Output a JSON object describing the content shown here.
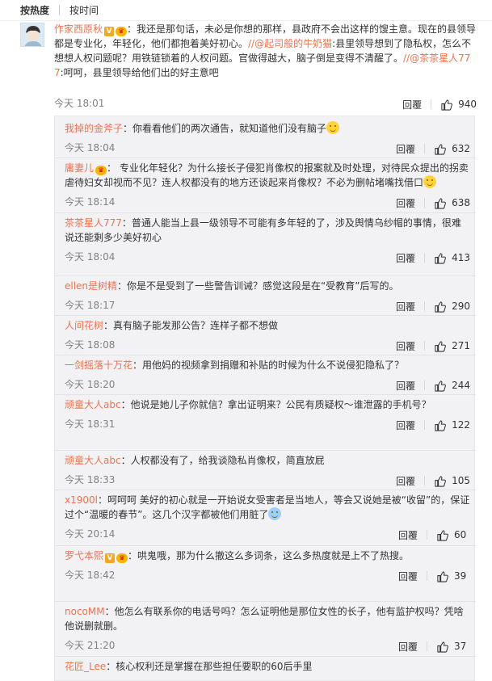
{
  "sort": {
    "hot": "按热度",
    "time": "按时间"
  },
  "main": {
    "user": "作家西原秋",
    "text1": "：我还是那句话，未必是你想的那样，县政府不会出这样的馊主意。现在的县领导都是专业化，年轻化，他们都抱着美好初心。",
    "mention1": "//@起司般的牛奶猫",
    "text2": ":县里领导想到了隐私权，怎么不想想人权问题呢？用铁链锁着的人权问题。官做得越大，脑子倒是变得不清醒了。",
    "mention2": "//@茶茶星人777",
    "text3": ":呵呵，县里领导给他们出的好主意吧",
    "time": "今天 18:01",
    "reply": "回覆",
    "likes": "940"
  },
  "replies": [
    {
      "user": "我掉的金斧子",
      "text": "：你看看他们的两次通告，就知道他们没有脑子",
      "emoji": "smile",
      "time": "今天 18:04",
      "reply": "回覆",
      "likes": "632"
    },
    {
      "user": "庸妻儿",
      "vip": true,
      "text": "： 专业化年轻化？为什么接长子侵犯肖像权的报案就及时处理，对待民众提出的拐卖虐待妇女却视而不见？连人权都没有的地方还谈起来肖像权？不必为删帖堵嘴找借口",
      "emoji": "smile",
      "time": "今天 18:14",
      "reply": "回覆",
      "likes": "638"
    },
    {
      "user": "茶茶星人777",
      "text": "：普通人能当上县一级领导不可能有多年轻的了，涉及舆情乌纱帽的事情，很难说还能剩多少美好初心",
      "time": "今天 18:04",
      "reply": "回覆",
      "likes": "413"
    },
    {
      "user": "ellen是树精",
      "text": "：你是不是受到了一些警告训诫？感觉这段是在“受教育”后写的。",
      "time": "今天 18:17",
      "reply": "回覆",
      "likes": "290"
    },
    {
      "user": "人间花树",
      "text": "：真有脑子能发那公告？连样子都不想做",
      "time": "今天 18:08",
      "reply": "回覆",
      "likes": "271"
    },
    {
      "user": "一剑摇落十万花",
      "text": "：用他妈的视频拿到捐赠和补贴的时候为什么不说侵犯隐私了？",
      "time": "今天 18:20",
      "reply": "回覆",
      "likes": "244"
    },
    {
      "user": "顽童大人abc",
      "text": "：他说是她儿子你就信？拿出证明来？公民有质疑权～谁泄露的手机号？",
      "time": "今天 18:31",
      "reply": "回覆",
      "likes": "122"
    },
    {
      "user": "顽童大人abc",
      "text": "：人权都没有了，给我谈隐私肖像权，简直放屁",
      "time": "今天 18:33",
      "reply": "回覆",
      "likes": "105"
    },
    {
      "user": "x1900l",
      "text": "：呵呵呵 美好的初心就是一开始说女受害者是当地人，等会又说她是被“收留”的，保证过个“温暖的春节”。这几个汉字都被他们用脏了",
      "emoji": "cry",
      "time": "今天 20:14",
      "reply": "回覆",
      "likes": "60"
    },
    {
      "user": "罗弋本熙",
      "v": true,
      "vip": true,
      "text": "：哄鬼哦，那为什么撤这么多词条，这么多热度就是上不了热搜。",
      "time": "今天 18:42",
      "reply": "回覆",
      "likes": "39"
    },
    {
      "user": "nocoMM",
      "text": "：他怎么有联系你的电话号吗？怎么证明他是那位女性的长子，他有监护权吗？凭啥他说删就删。",
      "time": "今天 21:20",
      "reply": "回覆",
      "likes": "37"
    },
    {
      "user": "花匠_Lee",
      "text": "：核心权利还是掌握在那些担任要职的60后手里"
    }
  ]
}
